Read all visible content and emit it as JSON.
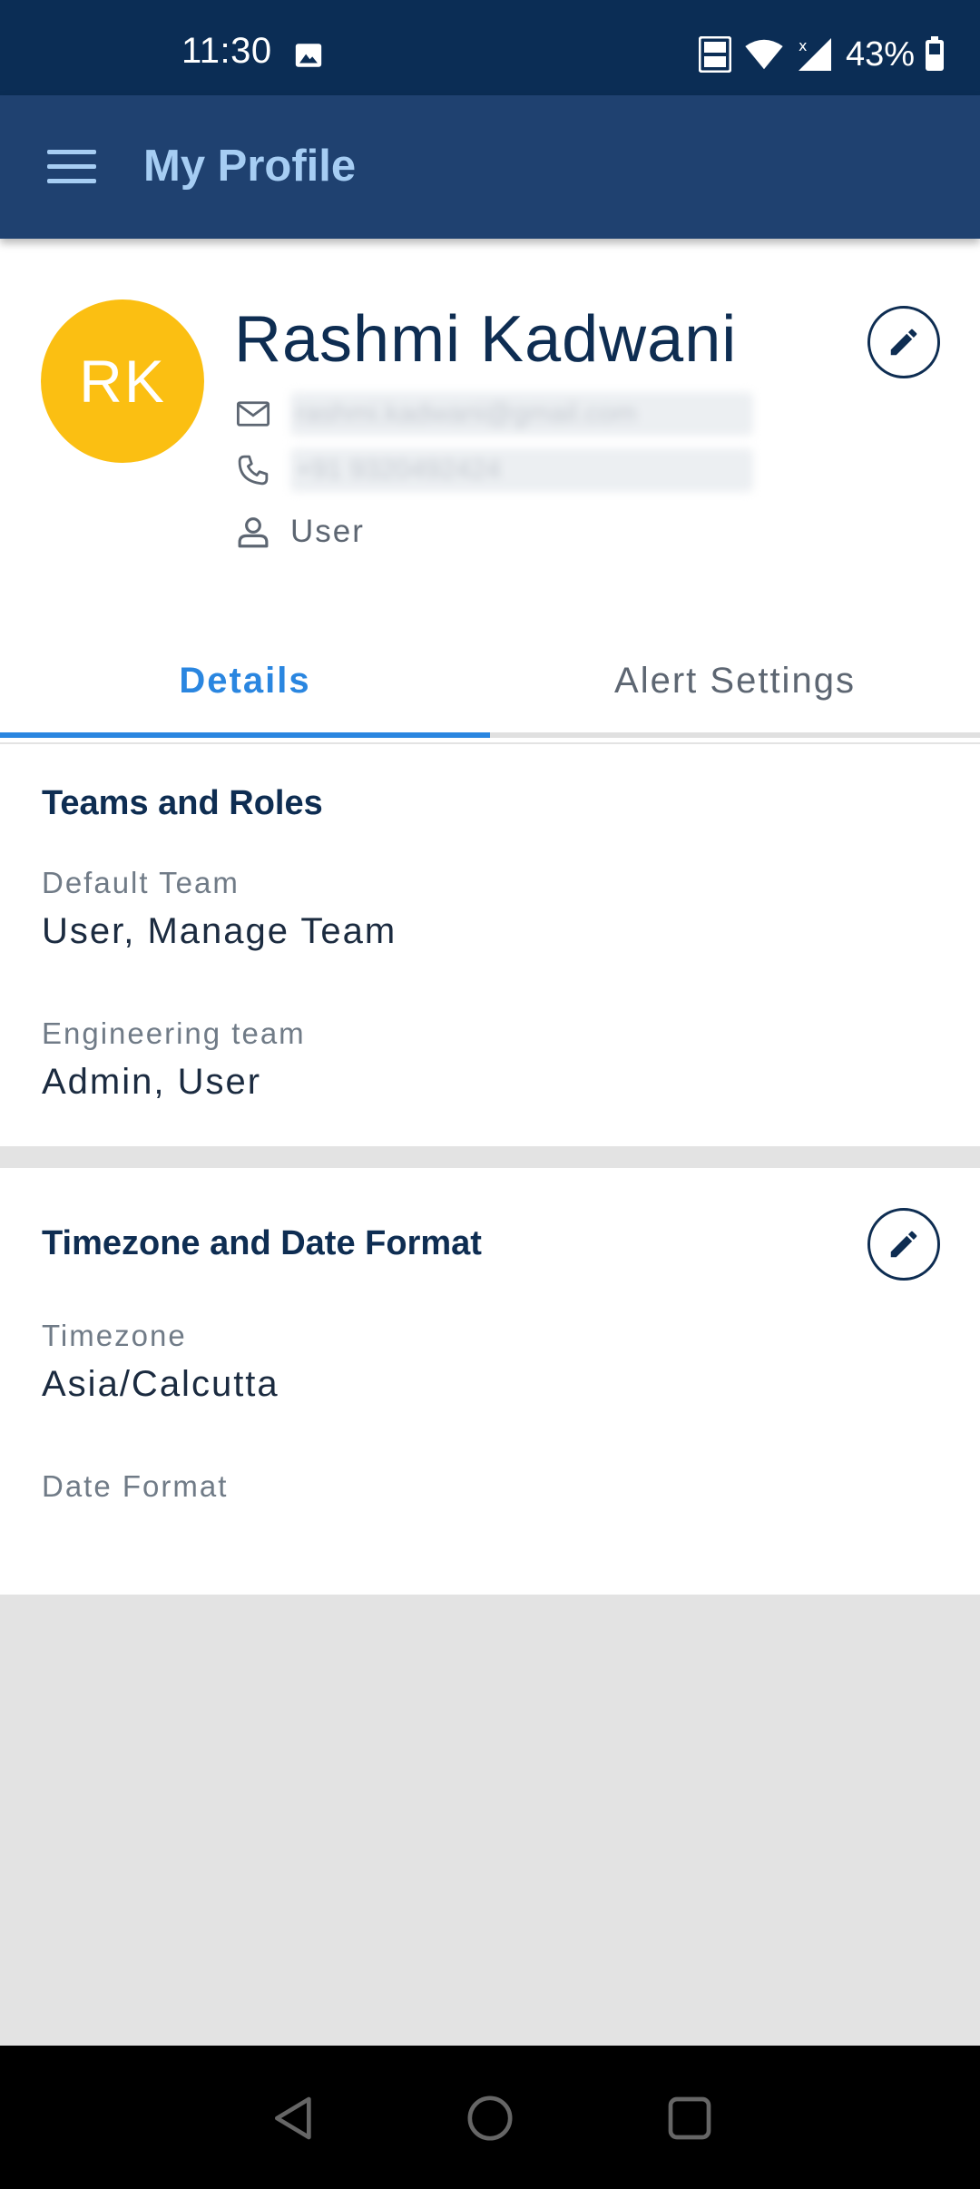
{
  "status_bar": {
    "time": "11:30",
    "battery": "43%"
  },
  "app_bar": {
    "title": "My Profile"
  },
  "profile": {
    "initials": "RK",
    "name": "Rashmi Kadwani",
    "email": "rashmi.kadwani@gmail.com",
    "phone": "+91 9320492424",
    "role": "User",
    "avatar_color": "#fbbf12"
  },
  "tabs": [
    {
      "label": "Details",
      "active": true
    },
    {
      "label": "Alert Settings",
      "active": false
    }
  ],
  "teams_section": {
    "title": "Teams and Roles",
    "fields": [
      {
        "label": "Default Team",
        "value": "User, Manage Team"
      },
      {
        "label": "Engineering team",
        "value": "Admin, User"
      }
    ]
  },
  "timezone_section": {
    "title": "Timezone and Date Format",
    "fields": [
      {
        "label": "Timezone",
        "value": "Asia/Calcutta"
      },
      {
        "label": "Date Format",
        "value": ""
      }
    ]
  },
  "icons": {
    "menu": "hamburger-menu-icon",
    "edit": "pencil-icon",
    "email": "envelope-icon",
    "phone": "phone-icon",
    "role": "person-icon"
  },
  "colors": {
    "status_bar": "#0b2d55",
    "app_bar": "#1f4170",
    "accent": "#2a86e0",
    "title_text": "#a6cdf3",
    "dark_text": "#0e2d52"
  }
}
